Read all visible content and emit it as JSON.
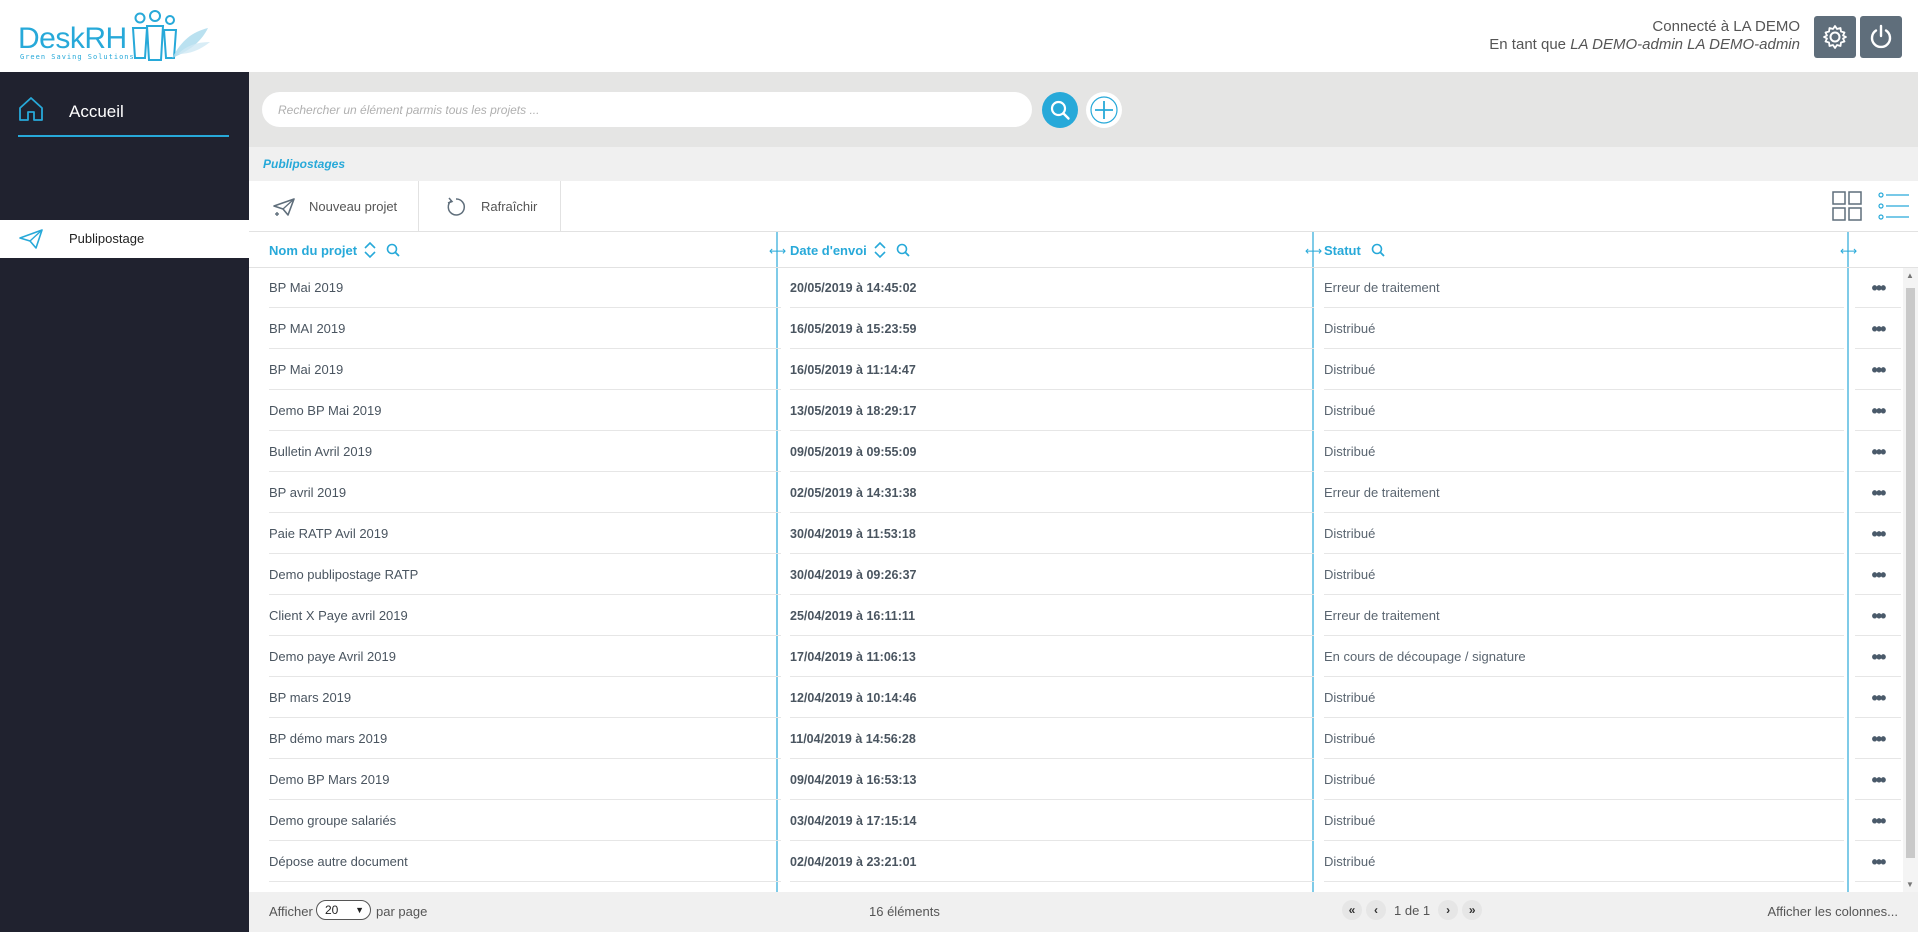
{
  "brand": {
    "name": "DeskRH",
    "tagline": "Green Saving Solutions"
  },
  "user": {
    "connected_prefix": "Connecté à LA DEMO",
    "as_prefix": "En tant que ",
    "as_user": "LA DEMO-admin LA DEMO-admin"
  },
  "header_buttons": {
    "settings_icon": "gear-icon",
    "logout_icon": "power-icon"
  },
  "sidebar": {
    "home_label": "Accueil",
    "items": [
      {
        "label": "Publipostage",
        "icon": "paper-plane-icon"
      }
    ]
  },
  "search": {
    "placeholder": "Rechercher un élément parmis tous les projets ..."
  },
  "breadcrumb": "Publipostages",
  "toolbar": {
    "new_label": "Nouveau projet",
    "refresh_label": "Rafraîchir"
  },
  "table": {
    "columns": [
      "Nom du projet",
      "Date d'envoi",
      "Statut"
    ],
    "rows": [
      {
        "name": "BP Mai 2019",
        "date": "20/05/2019 à 14:45:02",
        "status": "Erreur de traitement"
      },
      {
        "name": "BP MAI 2019",
        "date": "16/05/2019 à 15:23:59",
        "status": "Distribué"
      },
      {
        "name": "BP Mai 2019",
        "date": "16/05/2019 à 11:14:47",
        "status": "Distribué"
      },
      {
        "name": "Demo BP Mai 2019",
        "date": "13/05/2019 à 18:29:17",
        "status": "Distribué"
      },
      {
        "name": "Bulletin Avril 2019",
        "date": "09/05/2019 à 09:55:09",
        "status": "Distribué"
      },
      {
        "name": "BP avril 2019",
        "date": "02/05/2019 à 14:31:38",
        "status": "Erreur de traitement"
      },
      {
        "name": "Paie RATP Avil 2019",
        "date": "30/04/2019 à 11:53:18",
        "status": "Distribué"
      },
      {
        "name": "Demo publipostage RATP",
        "date": "30/04/2019 à 09:26:37",
        "status": "Distribué"
      },
      {
        "name": "Client X Paye avril 2019",
        "date": "25/04/2019 à 16:11:11",
        "status": "Erreur de traitement"
      },
      {
        "name": "Demo paye Avril 2019",
        "date": "17/04/2019 à 11:06:13",
        "status": "En cours de découpage / signature"
      },
      {
        "name": "BP mars 2019",
        "date": "12/04/2019 à 10:14:46",
        "status": "Distribué"
      },
      {
        "name": "BP démo mars 2019",
        "date": "11/04/2019 à 14:56:28",
        "status": "Distribué"
      },
      {
        "name": "Demo BP Mars 2019",
        "date": "09/04/2019 à 16:53:13",
        "status": "Distribué"
      },
      {
        "name": "Demo groupe salariés",
        "date": "03/04/2019 à 17:15:14",
        "status": "Distribué"
      },
      {
        "name": "Dépose autre document",
        "date": "02/04/2019 à 23:21:01",
        "status": "Distribué"
      }
    ]
  },
  "footer": {
    "show_label": "Afficher",
    "page_size": "20",
    "per_page_label": "par page",
    "count_label": "16 éléments",
    "page_label": "1 de 1",
    "columns_label": "Afficher les colonnes..."
  },
  "colors": {
    "accent": "#27a9d9",
    "sidebar": "#20222f",
    "header_button": "#5f6e7b"
  }
}
